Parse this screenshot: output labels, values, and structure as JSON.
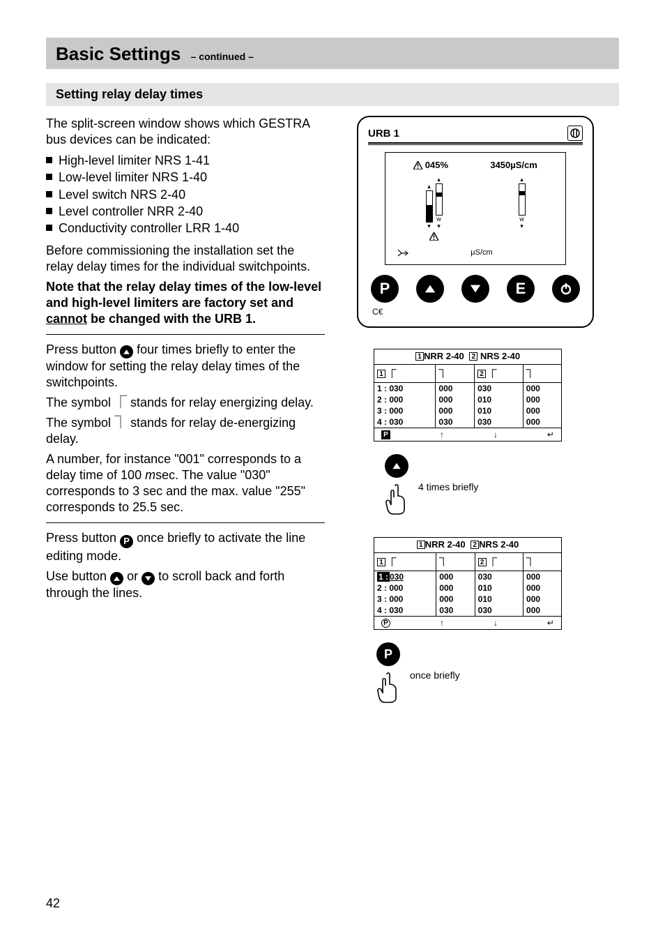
{
  "header": {
    "title": "Basic Settings",
    "continued": "– continued –"
  },
  "section": {
    "heading": "Setting relay delay times"
  },
  "intro": {
    "p1": "The split-screen window shows which GESTRA bus devices can be indicated:",
    "bullets": [
      "High-level limiter NRS 1-41",
      "Low-level limiter NRS 1-40",
      "Level switch NRS 2-40",
      "Level controller NRR 2-40",
      "Conductivity controller LRR 1-40"
    ],
    "p2": "Before commissioning the installation set the relay delay times for the individual switchpoints.",
    "note_a": "Note that the relay delay times of the low-level and high-level limiters are factory set and ",
    "note_cannot": "cannot",
    "note_b": " be changed with the URB 1."
  },
  "block2": {
    "p1a": "Press button ",
    "p1b": " four times briefly to enter the window for setting the relay delay times of the switchpoints.",
    "p2": "The symbol ⎾ stands for relay energizing delay.",
    "p3": "The symbol ⏋ stands for relay de-energizing delay.",
    "p4a": "A number, for instance \"001\" corresponds to a delay time of 100 ",
    "p4m": "m",
    "p4b": "sec. The value \"030\" corresponds to 3 sec and the max. value \"255\" corresponds to 25.5 sec."
  },
  "block3": {
    "p1a": "Press button ",
    "p1b": " once briefly to activate the line editing mode.",
    "p2a": "Use button ",
    "p2b": " or ",
    "p2c": " to scroll back and forth through the lines."
  },
  "device": {
    "title": "URB 1",
    "left_val": "045%",
    "right_val": "3450µS/cm",
    "bottom_unit": "µS/cm",
    "ce": "CE"
  },
  "table1": {
    "dev1": "NRR 2-40",
    "dev2": "NRS 2-40",
    "footP": "P",
    "rows": [
      {
        "c1": "1 : 030",
        "c2": "000",
        "c3": "030",
        "c4": "000"
      },
      {
        "c1": "2 : 000",
        "c2": "000",
        "c3": "010",
        "c4": "000"
      },
      {
        "c1": "3 : 000",
        "c2": "000",
        "c3": "010",
        "c4": "000"
      },
      {
        "c1": "4 : 030",
        "c2": "030",
        "c3": "030",
        "c4": "000"
      }
    ]
  },
  "table2": {
    "dev1": "NRR 2-40",
    "dev2": "NRS 2-40",
    "rows": [
      {
        "c1a": "1 :",
        "c1b": "030",
        "c2": "000",
        "c3": "030",
        "c4": "000"
      },
      {
        "c1": "2 : 000",
        "c2": "000",
        "c3": "010",
        "c4": "000"
      },
      {
        "c1": "3 : 000",
        "c2": "000",
        "c3": "010",
        "c4": "000"
      },
      {
        "c1": "4 : 030",
        "c2": "030",
        "c3": "030",
        "c4": "000"
      }
    ]
  },
  "hand1": "4 times briefly",
  "hand2": "once briefly",
  "page_number": "42",
  "icons": {
    "up": "▲",
    "down": "▼",
    "P": "P",
    "E": "E",
    "enter": "↵",
    "arr_up": "↑",
    "arr_down": "↓",
    "col_a": "⎾",
    "col_b": "⏋"
  },
  "sq": {
    "one": "1",
    "two": "2"
  }
}
